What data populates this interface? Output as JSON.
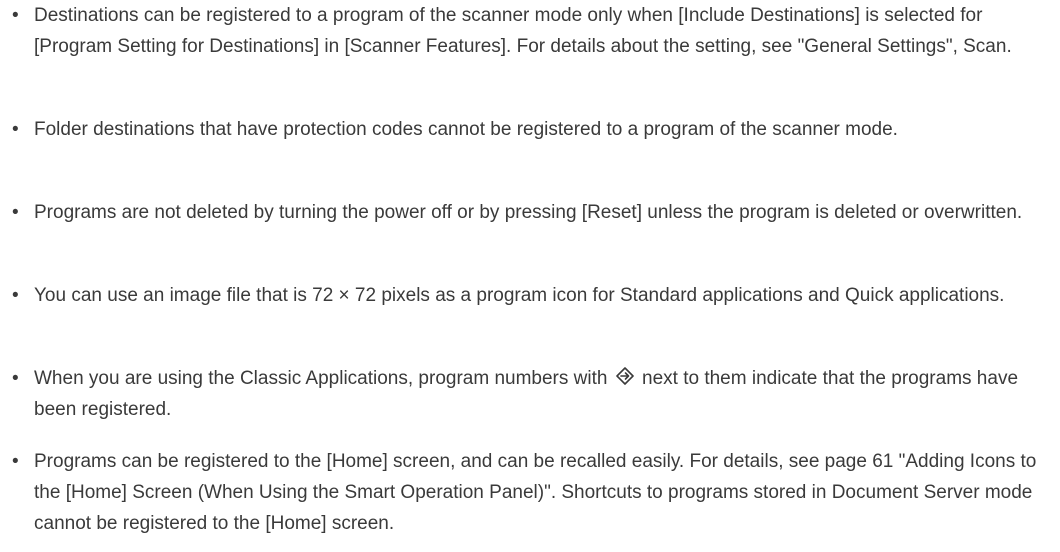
{
  "notes": [
    {
      "text": "Destinations can be registered to a program of the scanner mode only when [Include Destinations] is selected for [Program Setting for Destinations] in [Scanner Features]. For details about the setting, see \"General Settings\", Scan."
    },
    {
      "text": "Folder destinations that have protection codes cannot be registered to a program of the scanner mode."
    },
    {
      "text": "Programs are not deleted by turning the power off or by pressing [Reset] unless the program is deleted or overwritten."
    },
    {
      "text": "You can use an image file that is 72 × 72 pixels as a program icon for Standard applications and Quick applications."
    },
    {
      "text_before": "When you are using the Classic Applications, program numbers with",
      "icon": "program-registered-icon",
      "text_after": "next to them indicate that the programs have been registered."
    },
    {
      "text": "Programs can be registered to the [Home] screen, and can be recalled easily. For details, see page 61 \"Adding Icons to the [Home] Screen (When Using the Smart Operation Panel)\". Shortcuts to programs stored in Document Server mode cannot be registered to the [Home] screen."
    }
  ],
  "bullet_char": "•"
}
